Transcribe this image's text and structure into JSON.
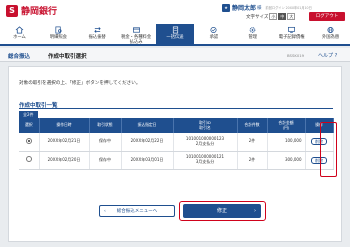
{
  "header": {
    "bank_name": "静岡銀行",
    "user_name": "静岡太郎",
    "user_honorific": "様",
    "last_login": "前回ログイン 20XX年01月10日",
    "text_size_label": "文字サイズ",
    "text_size_options": [
      "小",
      "中",
      "大"
    ],
    "logout_label": "ログアウト"
  },
  "nav": {
    "items": [
      {
        "label": "ホーム",
        "active": false
      },
      {
        "label": "明細照会",
        "active": false
      },
      {
        "label": "振込振替",
        "active": false
      },
      {
        "label": "税金・各種料金\n払込み",
        "active": false
      },
      {
        "label": "一括伝送",
        "active": true
      },
      {
        "label": "承認",
        "active": false
      },
      {
        "label": "管理",
        "active": false
      },
      {
        "label": "電子記録債権",
        "active": false
      },
      {
        "label": "外国為替",
        "active": false
      }
    ]
  },
  "titlebar": {
    "breadcrumb": "総合振込",
    "title": "作成中取引選択",
    "screen_id": "BSSK019",
    "help_label": "ヘルプ"
  },
  "main": {
    "instruction": "対象の取引を選択の上、「修正」ボタンを押してください。",
    "section_title": "作成中取引一覧",
    "count_label": "全2件",
    "table": {
      "headers": [
        "選択",
        "操作日時",
        "取引状態",
        "振込指定日",
        "取引ID\n取引名",
        "合計件数",
        "合計金額\n(円)",
        "操作"
      ],
      "rows": [
        {
          "selected": true,
          "datetime": "20XX年02月21日",
          "status": "保存中",
          "transfer_date": "20XX年02月22日",
          "id": "101001000000123",
          "name": "2月支払分",
          "count": "2件",
          "amount": "100,000",
          "action": "削除"
        },
        {
          "selected": false,
          "datetime": "20XX年02月20日",
          "status": "保存中",
          "transfer_date": "20XX年03月01日",
          "id": "101001000000121",
          "name": "3月支払分",
          "count": "2件",
          "amount": "300,000",
          "action": "削除"
        }
      ]
    }
  },
  "footer": {
    "back_label": "総合振込メニューへ",
    "fix_label": "修正"
  },
  "colors": {
    "brand_red": "#c8102e",
    "navy": "#1f4f8f",
    "highlight": "#d0021b"
  }
}
